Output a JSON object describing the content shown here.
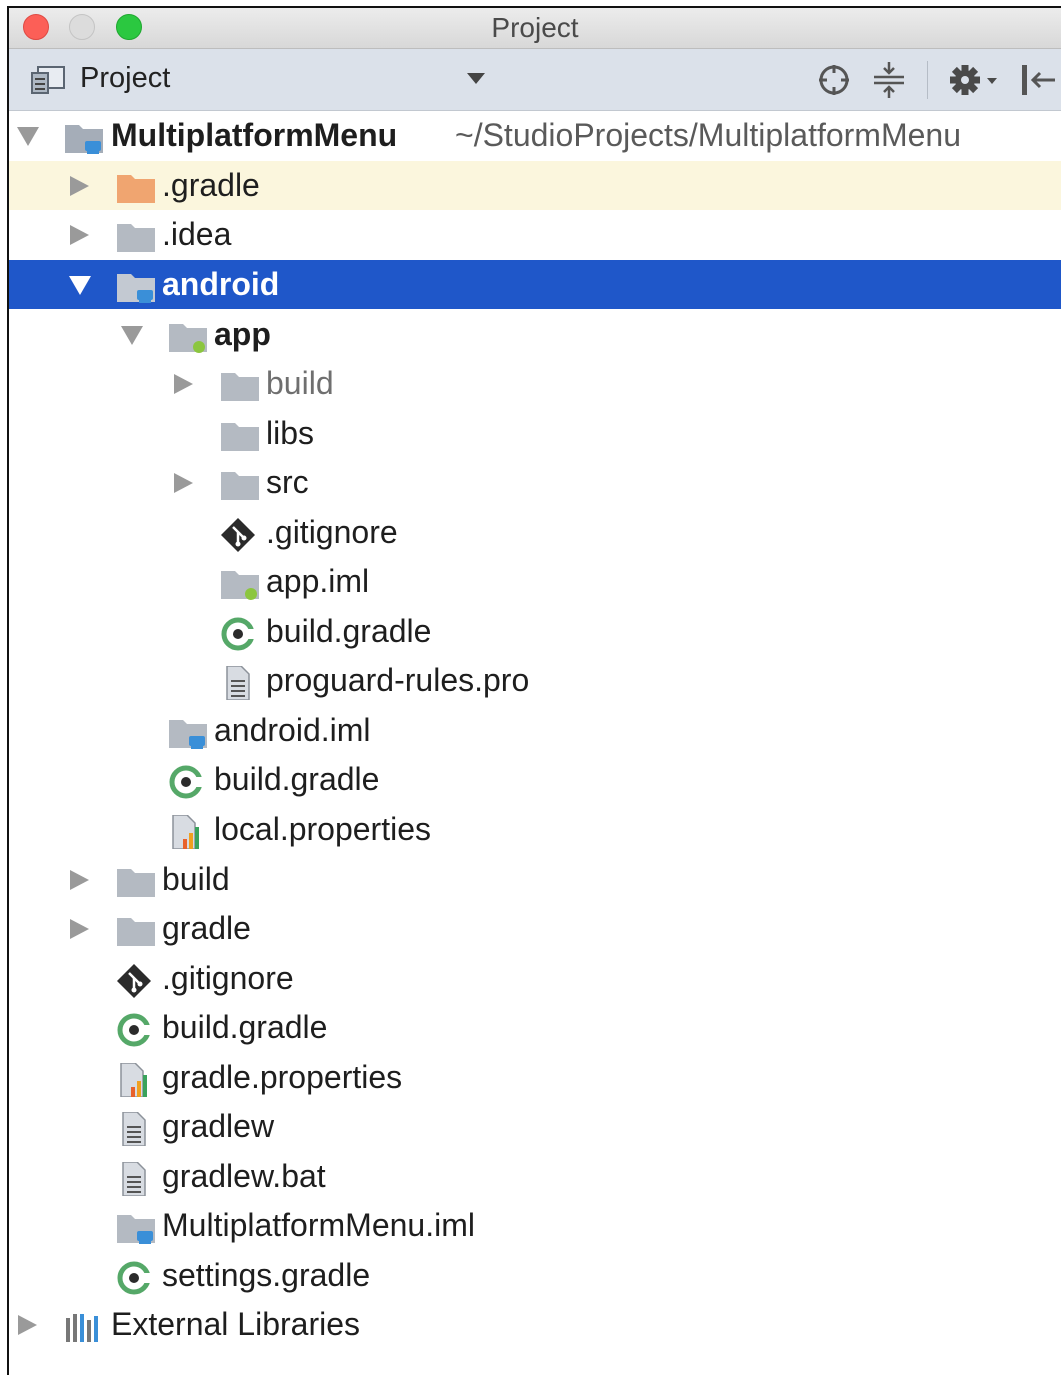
{
  "window": {
    "title": "Project"
  },
  "toolbar": {
    "view_label": "Project",
    "buttons": [
      "locate-icon",
      "collapse-all-icon",
      "gear-icon",
      "hide-icon"
    ]
  },
  "tree": {
    "root": {
      "name": "MultiplatformMenu",
      "path": "~/StudioProjects/MultiplatformMenu"
    },
    "items": [
      {
        "name": ".gradle"
      },
      {
        "name": ".idea"
      },
      {
        "name": "android"
      },
      {
        "name": "app"
      },
      {
        "name": "build"
      },
      {
        "name": "libs"
      },
      {
        "name": "src"
      },
      {
        "name": ".gitignore"
      },
      {
        "name": "app.iml"
      },
      {
        "name": "build.gradle"
      },
      {
        "name": "proguard-rules.pro"
      },
      {
        "name": "android.iml"
      },
      {
        "name": "build.gradle"
      },
      {
        "name": "local.properties"
      },
      {
        "name": "build"
      },
      {
        "name": "gradle"
      },
      {
        "name": ".gitignore"
      },
      {
        "name": "build.gradle"
      },
      {
        "name": "gradle.properties"
      },
      {
        "name": "gradlew"
      },
      {
        "name": "gradlew.bat"
      },
      {
        "name": "MultiplatformMenu.iml"
      },
      {
        "name": "settings.gradle"
      }
    ],
    "external": {
      "name": "External Libraries"
    }
  },
  "colors": {
    "selection": "#1f57c9",
    "highlight_row": "#fbf6dd",
    "toolbar": "#dbe1ea"
  }
}
